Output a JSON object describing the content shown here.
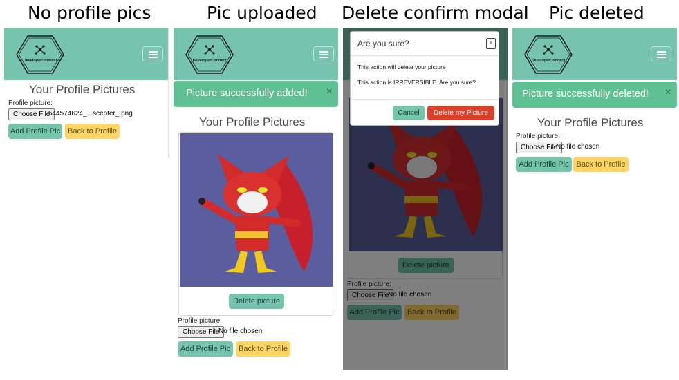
{
  "captions": {
    "p1": "No profile pics",
    "p2": "Pic uploaded",
    "p3": "Delete confirm modal",
    "p4": "Pic deleted"
  },
  "brand": {
    "name": "DeveloperConnect",
    "navbar_color": "#77c4ad",
    "success_color": "#5fc093",
    "danger_color": "#d9412b",
    "warning_color": "#ffd565"
  },
  "labels": {
    "heading": "Your Profile Pictures",
    "profile_picture": "Profile picture:",
    "choose_file": "Choose File",
    "no_file": "No file chosen",
    "add_button": "Add Profile Pic",
    "back_button": "Back to Profile",
    "delete_picture": "Delete picture"
  },
  "panel1": {
    "selected_file": "544574624_...scepter_.png"
  },
  "panel2": {
    "alert": "Picture successfully added!",
    "alert_close": "×"
  },
  "modal": {
    "title": "Are you sure?",
    "close": "×",
    "line1": "This action will delete your picture",
    "line2": "This action is IRREVERSIBLE. Are you sure?",
    "cancel": "Cancel",
    "confirm": "Delete my Picture"
  },
  "panel4": {
    "alert": "Picture successfully deleted!",
    "alert_close": "×"
  },
  "icons": {
    "hamburger": "hamburger-icon",
    "logo": "network-hexagon-logo",
    "close": "close-icon"
  }
}
